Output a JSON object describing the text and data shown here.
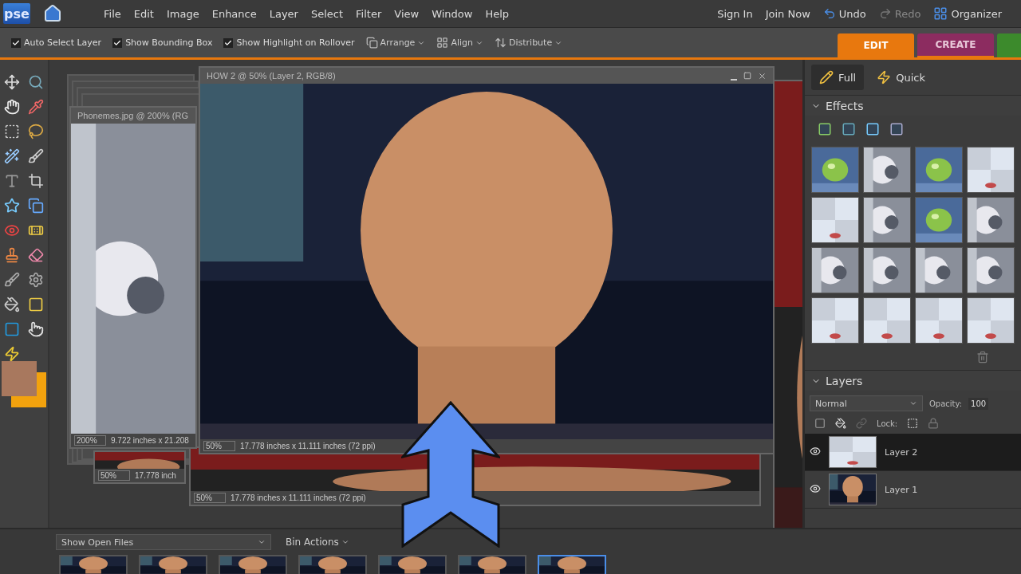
{
  "menu": {
    "logo": "pse",
    "items": [
      "File",
      "Edit",
      "Image",
      "Enhance",
      "Layer",
      "Select",
      "Filter",
      "View",
      "Window",
      "Help"
    ]
  },
  "account": [
    "Sign In",
    "Join Now"
  ],
  "history": [
    {
      "label": "Undo",
      "disabled": false
    },
    {
      "label": "Redo",
      "disabled": true
    }
  ],
  "organizer": "Organizer",
  "options": {
    "checkboxes": [
      {
        "label": "Auto Select Layer",
        "checked": true
      },
      {
        "label": "Show Bounding Box",
        "checked": true
      },
      {
        "label": "Show Highlight on Rollover",
        "checked": true
      }
    ],
    "dropdowns": [
      {
        "kind": "arrange",
        "label": "Arrange"
      },
      {
        "kind": "align",
        "label": "Align"
      },
      {
        "kind": "distribute",
        "label": "Distribute"
      }
    ]
  },
  "mode_tabs": [
    {
      "label": "EDIT",
      "selected": true,
      "color": "#e8780e"
    },
    {
      "label": "CREATE",
      "selected": false,
      "color": "#8c2c60"
    }
  ],
  "edit_modes": [
    {
      "label": "Full",
      "selected": true
    },
    {
      "label": "Quick",
      "selected": false
    }
  ],
  "documents": [
    {
      "kind": "main",
      "title": "HOW 2 @ 50% (Layer 2, RGB/8)",
      "zoom": "50%",
      "size": "17.778 inches x 11.111 inches (72 ppi)"
    },
    {
      "kind": "side",
      "title": "Phonemes.jpg @ 200% (RG",
      "zoom": "200%",
      "size": "9.722 inches x 21.208"
    },
    {
      "kind": "small",
      "zoom": "50%",
      "size": "17.778 inch"
    },
    {
      "kind": "back",
      "zoom": "50%",
      "size": "17.778 inches x 11.111 inches (72 ppi)"
    }
  ],
  "effects": {
    "title": "Effects"
  },
  "layers": {
    "title": "Layers",
    "blend_mode": "Normal",
    "opacity_label": "Opacity:",
    "opacity": "100",
    "lock_label": "Lock:",
    "items": [
      {
        "name": "Layer 2",
        "selected": true,
        "visible": true
      },
      {
        "name": "Layer 1",
        "selected": false,
        "visible": true
      }
    ]
  },
  "bin": {
    "filter": "Show Open Files",
    "actions": "Bin Actions",
    "thumbnails": [
      {
        "selected": false
      },
      {
        "selected": false
      },
      {
        "selected": false
      },
      {
        "selected": false
      },
      {
        "selected": false
      },
      {
        "selected": false
      },
      {
        "selected": true
      }
    ]
  }
}
